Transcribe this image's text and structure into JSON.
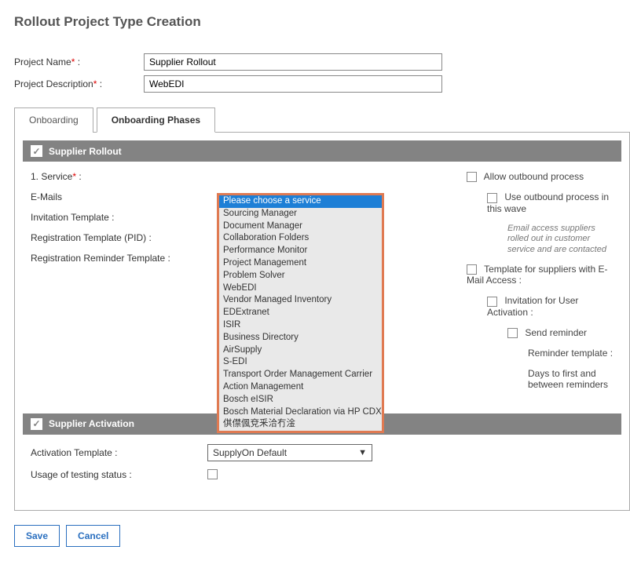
{
  "page_title": "Rollout Project Type Creation",
  "form": {
    "project_name_label": "Project Name",
    "project_name_value": "Supplier Rollout",
    "project_desc_label": "Project Description",
    "project_desc_value": "WebEDI"
  },
  "tabs": {
    "onboarding": "Onboarding",
    "onboarding_phases": "Onboarding Phases"
  },
  "supplier_rollout": {
    "header": "Supplier Rollout",
    "service_label": "1. Service",
    "emails_label": "E-Mails",
    "invitation_template_label": "Invitation Template :",
    "registration_template_label": "Registration Template (PID) :",
    "registration_reminder_label": "Registration Reminder Template :",
    "dropdown_selected": "Please choose a service",
    "dropdown_options": [
      "Please choose a service",
      "Sourcing Manager",
      "Document Manager",
      "Collaboration Folders",
      "Performance Monitor",
      "Project Management",
      "Problem Solver",
      "WebEDI",
      "Vendor Managed Inventory",
      "EDExtranet",
      "ISIR",
      "Business Directory",
      "AirSupply",
      "S-EDI",
      "Transport Order Management Carrier",
      "Action Management",
      "Bosch eISIR",
      "Bosch Material Declaration via HP CDX",
      "倛僸偑兗釆洽冇淦"
    ],
    "right": {
      "allow_outbound": "Allow outbound process",
      "use_outbound_wave": "Use outbound process in this wave",
      "note": "Email access suppliers rolled out in customer service and are contacted",
      "template_email_access": "Template for suppliers with E-Mail Access :",
      "invitation_user_activation": "Invitation for User Activation :",
      "send_reminder": "Send reminder",
      "reminder_template": "Reminder template :",
      "days_first_between": "Days to first and between reminders"
    }
  },
  "supplier_activation": {
    "header": "Supplier Activation",
    "activation_template_label": "Activation Template :",
    "activation_template_value": "SupplyOn Default",
    "usage_testing_label": "Usage of testing status :"
  },
  "buttons": {
    "save": "Save",
    "cancel": "Cancel"
  },
  "colors": {
    "accent_blue": "#2a6fbf",
    "section_grey": "#838383",
    "dropdown_border": "#e07a52",
    "option_selected": "#1e7fd6"
  }
}
